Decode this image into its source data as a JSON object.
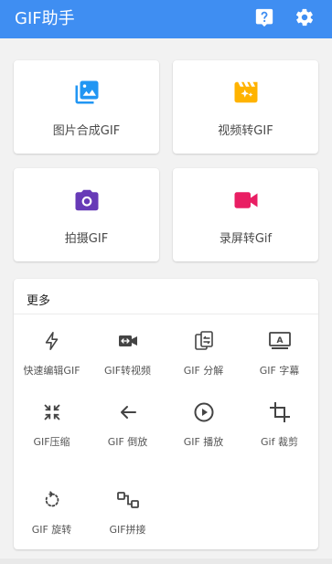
{
  "app_bar": {
    "title": "GIF助手",
    "background": "#3f8ef2",
    "help_icon": "help-icon",
    "settings_icon": "settings-icon"
  },
  "main_cards": [
    {
      "label": "图片合成GIF",
      "icon": "photo-library-icon",
      "color": "#2196f3"
    },
    {
      "label": "视频转GIF",
      "icon": "movie-sparkle-icon",
      "color": "#ffb300"
    },
    {
      "label": "拍摄GIF",
      "icon": "camera-icon",
      "color": "#673ab7"
    },
    {
      "label": "录屏转Gif",
      "icon": "videocam-icon",
      "color": "#e91e63"
    }
  ],
  "more": {
    "title": "更多",
    "tools": [
      {
        "label": "快速编辑GIF",
        "icon": "flash-icon"
      },
      {
        "label": "GIF转视频",
        "icon": "video-convert-icon"
      },
      {
        "label": "GIF 分解",
        "icon": "split-icon"
      },
      {
        "label": "GIF 字幕",
        "icon": "caption-icon"
      },
      {
        "label": "GIF压缩",
        "icon": "compress-icon"
      },
      {
        "label": "GIF 倒放",
        "icon": "reverse-arrow-icon"
      },
      {
        "label": "GIF 播放",
        "icon": "play-circle-icon"
      },
      {
        "label": "Gif 裁剪",
        "icon": "crop-icon"
      },
      {
        "label": "GIF 旋转",
        "icon": "rotate-icon"
      },
      {
        "label": "GIF拼接",
        "icon": "join-icon"
      }
    ]
  }
}
